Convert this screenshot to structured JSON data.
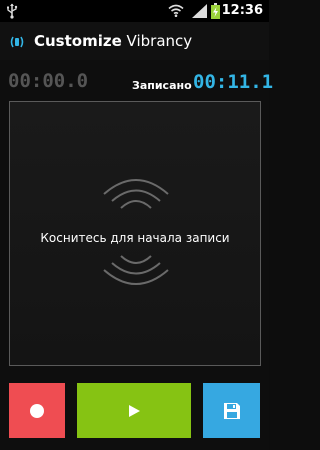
{
  "status_bar": {
    "time": "12:36",
    "icons": [
      "usb-icon",
      "wifi-icon",
      "signal-icon",
      "battery-charging-icon"
    ]
  },
  "action_bar": {
    "title_bold": "Customize",
    "title_light": " Vibrancy",
    "icon": "vibration-icon"
  },
  "timer": {
    "elapsed": "00:00.0",
    "recorded_label": "Записано",
    "recorded_value": "00:11.1"
  },
  "touch_area": {
    "hint": "Коснитесь для начала записи",
    "icon": "vibration-waves-icon"
  },
  "buttons": {
    "record": {
      "icon": "record-icon",
      "color": "#ef4d52"
    },
    "play": {
      "icon": "play-icon",
      "color": "#86c313"
    },
    "save": {
      "icon": "save-icon",
      "color": "#36a8e1"
    }
  },
  "colors": {
    "accent": "#33b5e5",
    "background": "#0e0e0e"
  }
}
